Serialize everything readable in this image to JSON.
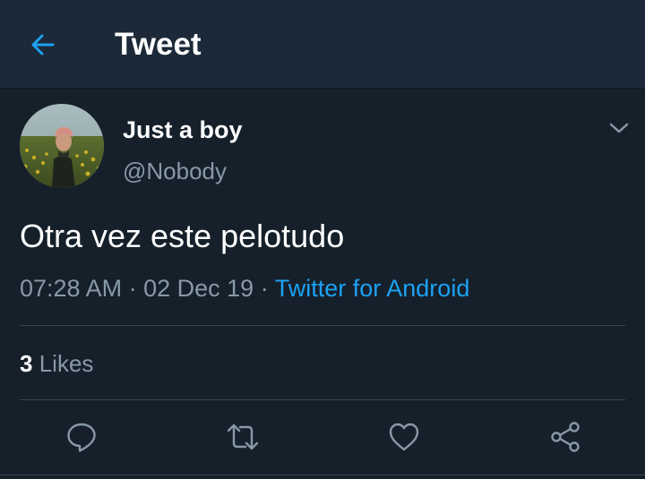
{
  "header": {
    "title": "Tweet",
    "back_icon": "arrow-left-icon"
  },
  "tweet": {
    "author": {
      "display_name": "Just a boy",
      "handle": "@Nobody"
    },
    "text": "Otra vez este pelotudo",
    "time": "07:28 AM",
    "separator": "·",
    "date": "02 Dec 19",
    "source": "Twitter for Android",
    "likes": {
      "count": "3",
      "label": "Likes"
    }
  },
  "actions": [
    {
      "name": "reply",
      "icon": "speech-bubble-icon"
    },
    {
      "name": "retweet",
      "icon": "retweet-icon"
    },
    {
      "name": "like",
      "icon": "heart-icon"
    },
    {
      "name": "share",
      "icon": "share-icon"
    }
  ],
  "colors": {
    "background": "#15202b",
    "header_background": "#1c2938",
    "accent": "#1da1f2",
    "secondary_text": "#8899a6",
    "divider": "#38444d"
  }
}
